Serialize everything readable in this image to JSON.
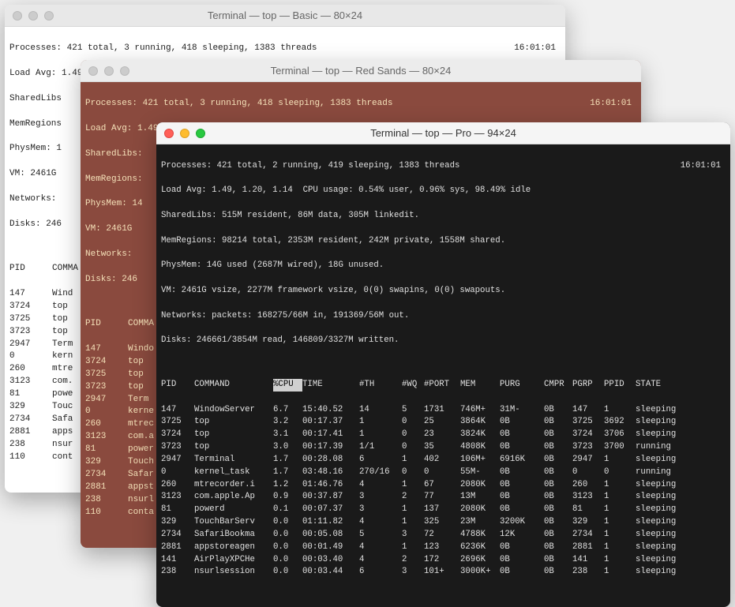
{
  "windows": {
    "basic": {
      "title": "Terminal — top — Basic — 80×24",
      "time": "16:01:01",
      "lines": [
        "Processes: 421 total, 3 running, 418 sleeping, 1383 threads",
        "Load Avg: 1.49, 1.20, 1.14  CPU usage: 0.48% user, 0.84% sys, 98.67% idle",
        "SharedLibs",
        "MemRegions",
        "PhysMem: 1",
        "VM: 2461G",
        "Networks:",
        "Disks: 246"
      ],
      "columns": [
        "PID",
        "COMMA"
      ],
      "rows": [
        [
          "147",
          "Wind"
        ],
        [
          "3724",
          "top"
        ],
        [
          "3725",
          "top"
        ],
        [
          "3723",
          "top"
        ],
        [
          "2947",
          "Term"
        ],
        [
          "0",
          "kern"
        ],
        [
          "260",
          "mtre"
        ],
        [
          "3123",
          "com."
        ],
        [
          "81",
          "powe"
        ],
        [
          "329",
          "Touc"
        ],
        [
          "2734",
          "Safa"
        ],
        [
          "2881",
          "apps"
        ],
        [
          "238",
          "nsur"
        ],
        [
          "110",
          "cont"
        ]
      ]
    },
    "redsands": {
      "title": "Terminal — top — Red Sands — 80×24",
      "time": "16:01:01",
      "lines": [
        "Processes: 421 total, 3 running, 418 sleeping, 1383 threads",
        "Load Avg: 1.49, 1.20, 1.14  CPU usage: 0.48% user, 0.84% sys, 98.67% idle",
        "SharedLibs:",
        "MemRegions:",
        "PhysMem: 14",
        "VM: 2461G",
        "Networks:",
        "Disks: 246"
      ],
      "columns": [
        "PID",
        "COMMA"
      ],
      "rows": [
        [
          "147",
          "Windo"
        ],
        [
          "3724",
          "top"
        ],
        [
          "3725",
          "top"
        ],
        [
          "3723",
          "top"
        ],
        [
          "2947",
          "Term"
        ],
        [
          "0",
          "kerne"
        ],
        [
          "260",
          "mtrec"
        ],
        [
          "3123",
          "com.a"
        ],
        [
          "81",
          "power"
        ],
        [
          "329",
          "Touch"
        ],
        [
          "2734",
          "Safar"
        ],
        [
          "2881",
          "appst"
        ],
        [
          "238",
          "nsurl"
        ],
        [
          "110",
          "conta"
        ]
      ]
    },
    "pro": {
      "title": "Terminal — top — Pro — 94×24",
      "time": "16:01:01",
      "lines": [
        "Processes: 421 total, 2 running, 419 sleeping, 1383 threads",
        "Load Avg: 1.49, 1.20, 1.14  CPU usage: 0.54% user, 0.96% sys, 98.49% idle",
        "SharedLibs: 515M resident, 86M data, 305M linkedit.",
        "MemRegions: 98214 total, 2353M resident, 242M private, 1558M shared.",
        "PhysMem: 14G used (2687M wired), 18G unused.",
        "VM: 2461G vsize, 2277M framework vsize, 0(0) swapins, 0(0) swapouts.",
        "Networks: packets: 168275/66M in, 191369/56M out.",
        "Disks: 246661/3854M read, 146809/3327M written."
      ],
      "columns": [
        "PID",
        "COMMAND",
        "%CPU",
        "TIME",
        "#TH",
        "#WQ",
        "#PORT",
        "MEM",
        "PURG",
        "CMPR",
        "PGRP",
        "PPID",
        "STATE"
      ],
      "rows": [
        [
          "147",
          "WindowServer",
          "6.7",
          "15:40.52",
          "14",
          "5",
          "1731",
          "746M+",
          "31M-",
          "0B",
          "147",
          "1",
          "sleeping"
        ],
        [
          "3725",
          "top",
          "3.2",
          "00:17.37",
          "1",
          "0",
          "25",
          "3864K",
          "0B",
          "0B",
          "3725",
          "3692",
          "sleeping"
        ],
        [
          "3724",
          "top",
          "3.1",
          "00:17.41",
          "1",
          "0",
          "23",
          "3824K",
          "0B",
          "0B",
          "3724",
          "3706",
          "sleeping"
        ],
        [
          "3723",
          "top",
          "3.0",
          "00:17.39",
          "1/1",
          "0",
          "35",
          "4808K",
          "0B",
          "0B",
          "3723",
          "3700",
          "running"
        ],
        [
          "2947",
          "Terminal",
          "1.7",
          "00:28.08",
          "6",
          "1",
          "402",
          "106M+",
          "6916K",
          "0B",
          "2947",
          "1",
          "sleeping"
        ],
        [
          "0",
          "kernel_task",
          "1.7",
          "03:48.16",
          "270/16",
          "0",
          "0",
          "55M-",
          "0B",
          "0B",
          "0",
          "0",
          "running"
        ],
        [
          "260",
          "mtrecorder.i",
          "1.2",
          "01:46.76",
          "4",
          "1",
          "67",
          "2080K",
          "0B",
          "0B",
          "260",
          "1",
          "sleeping"
        ],
        [
          "3123",
          "com.apple.Ap",
          "0.9",
          "00:37.87",
          "3",
          "2",
          "77",
          "13M",
          "0B",
          "0B",
          "3123",
          "1",
          "sleeping"
        ],
        [
          "81",
          "powerd",
          "0.1",
          "00:07.37",
          "3",
          "1",
          "137",
          "2080K",
          "0B",
          "0B",
          "81",
          "1",
          "sleeping"
        ],
        [
          "329",
          "TouchBarServ",
          "0.0",
          "01:11.82",
          "4",
          "1",
          "325",
          "23M",
          "3200K",
          "0B",
          "329",
          "1",
          "sleeping"
        ],
        [
          "2734",
          "SafariBookma",
          "0.0",
          "00:05.08",
          "5",
          "3",
          "72",
          "4788K",
          "12K",
          "0B",
          "2734",
          "1",
          "sleeping"
        ],
        [
          "2881",
          "appstoreagen",
          "0.0",
          "00:01.49",
          "4",
          "1",
          "123",
          "6236K",
          "0B",
          "0B",
          "2881",
          "1",
          "sleeping"
        ],
        [
          "141",
          "AirPlayXPCHe",
          "0.0",
          "00:03.40",
          "4",
          "2",
          "172",
          "2696K",
          "0B",
          "0B",
          "141",
          "1",
          "sleeping"
        ],
        [
          "238",
          "nsurlsession",
          "0.0",
          "00:03.44",
          "6",
          "3",
          "101+",
          "3000K+",
          "0B",
          "0B",
          "238",
          "1",
          "sleeping"
        ]
      ]
    }
  }
}
